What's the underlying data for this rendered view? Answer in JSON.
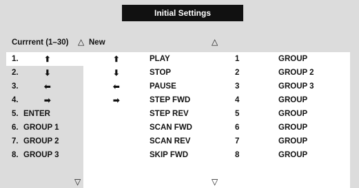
{
  "title": "Initial Settings",
  "current_header": "Currrent (1–30)",
  "new_header": "New",
  "scroll_up_glyph": "△",
  "scroll_down_glyph": "▽",
  "current_items": [
    {
      "num": "1.",
      "label": "⬆",
      "arrow": true
    },
    {
      "num": "2.",
      "label": "⬇",
      "arrow": true
    },
    {
      "num": "3.",
      "label": "⬅",
      "arrow": true
    },
    {
      "num": "4.",
      "label": "➡",
      "arrow": true
    },
    {
      "num": "5.",
      "label": "ENTER"
    },
    {
      "num": "6.",
      "label": "GROUP  1"
    },
    {
      "num": "7.",
      "label": "GROUP  2"
    },
    {
      "num": "8.",
      "label": "GROUP  3"
    }
  ],
  "new_rows": [
    {
      "arrow": "⬆",
      "function": "PLAY",
      "number": "1",
      "group": "GROUP"
    },
    {
      "arrow": "⬇",
      "function": "STOP",
      "number": "2",
      "group": "GROUP 2"
    },
    {
      "arrow": "⬅",
      "function": "PAUSE",
      "number": "3",
      "group": "GROUP 3"
    },
    {
      "arrow": "➡",
      "function": "STEP FWD",
      "number": "4",
      "group": "GROUP"
    },
    {
      "arrow": "",
      "function": "STEP REV",
      "number": "5",
      "group": "GROUP"
    },
    {
      "arrow": "",
      "function": "SCAN FWD",
      "number": "6",
      "group": "GROUP"
    },
    {
      "arrow": "",
      "function": "SCAN REV",
      "number": "7",
      "group": "GROUP"
    },
    {
      "arrow": "",
      "function": "SKIP FWD",
      "number": "8",
      "group": "GROUP"
    }
  ]
}
